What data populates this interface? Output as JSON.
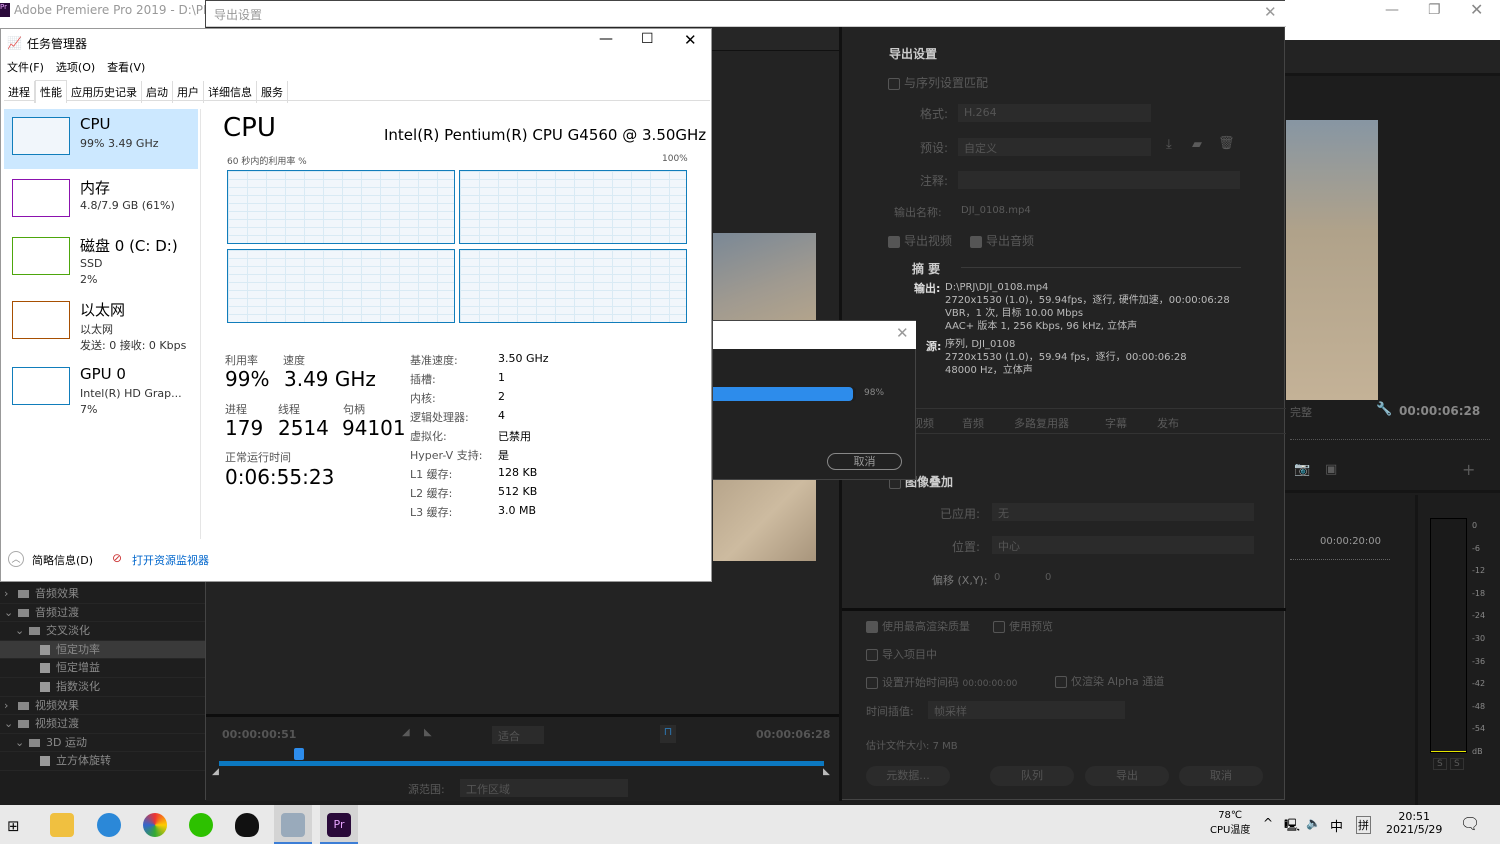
{
  "premiere": {
    "title": "Adobe Premiere Pro 2019 - D:\\PRJ\\",
    "timecode": "00:00:06:28",
    "quality": "完整",
    "ruler_time": "00:00:20:00",
    "meter_ticks": [
      "0",
      "-6",
      "-12",
      "-18",
      "-24",
      "-30",
      "-36",
      "-42",
      "-48",
      "-54",
      "dB"
    ],
    "solo": [
      "S",
      "S"
    ]
  },
  "export": {
    "title": "导出设置",
    "section": "导出设置",
    "match_seq": "与序列设置匹配",
    "format_label": "格式:",
    "format": "H.264",
    "preset_label": "预设:",
    "preset": "自定义",
    "comment_label": "注释:",
    "output_name_label": "输出名称:",
    "output_name": "DJI_0108.mp4",
    "export_video": "导出视频",
    "export_audio": "导出音频",
    "summary_title": "摘 要",
    "output_label": "输出:",
    "output_lines": [
      "D:\\PRJ\\DJI_0108.mp4",
      "2720x1530 (1.0)，59.94fps，逐行, 硬件加速，00:00:06:28",
      "VBR，1 次, 目标 10.00 Mbps",
      "AAC+ 版本 1, 256 Kbps, 96 kHz, 立体声"
    ],
    "source_label": "源:",
    "source_lines": [
      "序列, DJI_0108",
      "2720x1530 (1.0)，59.94 fps，逐行，00:00:06:28",
      "48000 Hz，立体声"
    ],
    "tabs": [
      "视频",
      "音频",
      "多路复用器",
      "字幕",
      "发布"
    ],
    "overlay_title": "图像叠加",
    "applied_label": "已应用:",
    "applied": "无",
    "position_label": "位置:",
    "position": "中心",
    "offset_label": "偏移 (X,Y):",
    "offset_x": "0",
    "offset_y": "0",
    "max_quality": "使用最高渲染质量",
    "use_preview": "使用预览",
    "import_project": "导入项目中",
    "set_timecode": "设置开始时间码",
    "timecode_value": "00:00:00:00",
    "alpha_only": "仅渲染 Alpha 通道",
    "interp_label": "时间插值:",
    "interp": "帧采样",
    "filesize_label": "估计文件大小:",
    "filesize": "7 MB",
    "buttons": {
      "metadata": "元数据...",
      "queue": "队列",
      "export": "导出",
      "cancel": "取消"
    },
    "timeline": {
      "current": "00:00:00:51",
      "end": "00:00:06:28",
      "fit": "适合",
      "source_range_label": "源范围:",
      "source_range": "工作区域"
    }
  },
  "progress": {
    "percent_label": "98%",
    "percent": 98,
    "cancel": "取消"
  },
  "taskmgr": {
    "title": "任务管理器",
    "menu": [
      "文件(F)",
      "选项(O)",
      "查看(V)"
    ],
    "tabs": [
      "进程",
      "性能",
      "应用历史记录",
      "启动",
      "用户",
      "详细信息",
      "服务"
    ],
    "active_tab": "性能",
    "sidebar": [
      {
        "name": "CPU",
        "l1": "99% 3.49 GHz",
        "l2": "",
        "color": "#117dbb"
      },
      {
        "name": "内存",
        "l1": "4.8/7.9 GB (61%)",
        "l2": "",
        "color": "#8b12ae"
      },
      {
        "name": "磁盘 0 (C: D:)",
        "l1": "SSD",
        "l2": "2%",
        "color": "#4da60c"
      },
      {
        "name": "以太网",
        "l1": "以太网",
        "l2": "发送: 0 接收: 0 Kbps",
        "color": "#a74f01"
      },
      {
        "name": "GPU 0",
        "l1": "Intel(R) HD Grap...",
        "l2": "7%",
        "color": "#117dbb"
      }
    ],
    "heading": "CPU",
    "cpu_model": "Intel(R) Pentium(R) CPU G4560 @ 3.50GHz",
    "graph_label": "60 秒内的利用率 %",
    "graph_max": "100%",
    "util_label": "利用率",
    "util": "99%",
    "speed_label": "速度",
    "speed": "3.49 GHz",
    "proc_label": "进程",
    "proc": "179",
    "threads_label": "线程",
    "threads": "2514",
    "handles_label": "句柄",
    "handles": "94101",
    "uptime_label": "正常运行时间",
    "uptime": "0:06:55:23",
    "specs": [
      [
        "基准速度:",
        "3.50 GHz"
      ],
      [
        "插槽:",
        "1"
      ],
      [
        "内核:",
        "2"
      ],
      [
        "逻辑处理器:",
        "4"
      ],
      [
        "虚拟化:",
        "已禁用"
      ],
      [
        "Hyper-V 支持:",
        "是"
      ],
      [
        "L1 缓存:",
        "128 KB"
      ],
      [
        "L2 缓存:",
        "512 KB"
      ],
      [
        "L3 缓存:",
        "3.0 MB"
      ]
    ],
    "brief": "简略信息(D)",
    "resmon": "打开资源监视器"
  },
  "effects_tree": [
    {
      "label": "音频效果",
      "type": "folder",
      "open": false,
      "level": 0
    },
    {
      "label": "音频过渡",
      "type": "folder",
      "open": true,
      "level": 0
    },
    {
      "label": "交叉淡化",
      "type": "folder",
      "open": true,
      "level": 1
    },
    {
      "label": "恒定功率",
      "type": "fx",
      "level": 2,
      "selected": true
    },
    {
      "label": "恒定增益",
      "type": "fx",
      "level": 2
    },
    {
      "label": "指数淡化",
      "type": "fx",
      "level": 2
    },
    {
      "label": "视频效果",
      "type": "folder",
      "open": false,
      "level": 0
    },
    {
      "label": "视频过渡",
      "type": "folder",
      "open": true,
      "level": 0
    },
    {
      "label": "3D 运动",
      "type": "folder",
      "open": true,
      "level": 1
    },
    {
      "label": "立方体旋转",
      "type": "fx",
      "level": 2
    }
  ],
  "taskbar": {
    "temp": "78℃",
    "temp_label": "CPU温度",
    "ime1": "中",
    "ime2": "拼",
    "time": "20:51",
    "date": "2021/5/29"
  }
}
